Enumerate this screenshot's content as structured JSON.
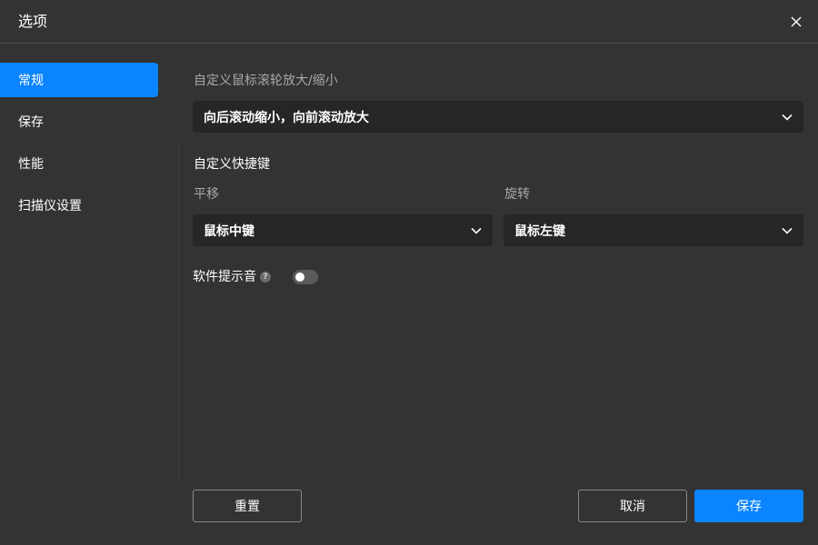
{
  "dialog": {
    "title": "选项",
    "close_icon": "close-icon"
  },
  "sidebar": {
    "items": [
      {
        "label": "常规",
        "active": true
      },
      {
        "label": "保存",
        "active": false
      },
      {
        "label": "性能",
        "active": false
      },
      {
        "label": "扫描仪设置",
        "active": false
      }
    ]
  },
  "general": {
    "wheel_zoom_label": "自定义鼠标滚轮放大/缩小",
    "wheel_zoom_value": "向后滚动缩小，向前滚动放大",
    "shortcuts_label": "自定义快捷键",
    "pan_label": "平移",
    "pan_value": "鼠标中键",
    "rotate_label": "旋转",
    "rotate_value": "鼠标左键",
    "sound_label": "软件提示音",
    "sound_help": "?",
    "sound_enabled": false
  },
  "footer": {
    "reset_label": "重置",
    "cancel_label": "取消",
    "save_label": "保存"
  },
  "colors": {
    "accent": "#0a84ff",
    "background": "#333333",
    "field": "#262626"
  }
}
